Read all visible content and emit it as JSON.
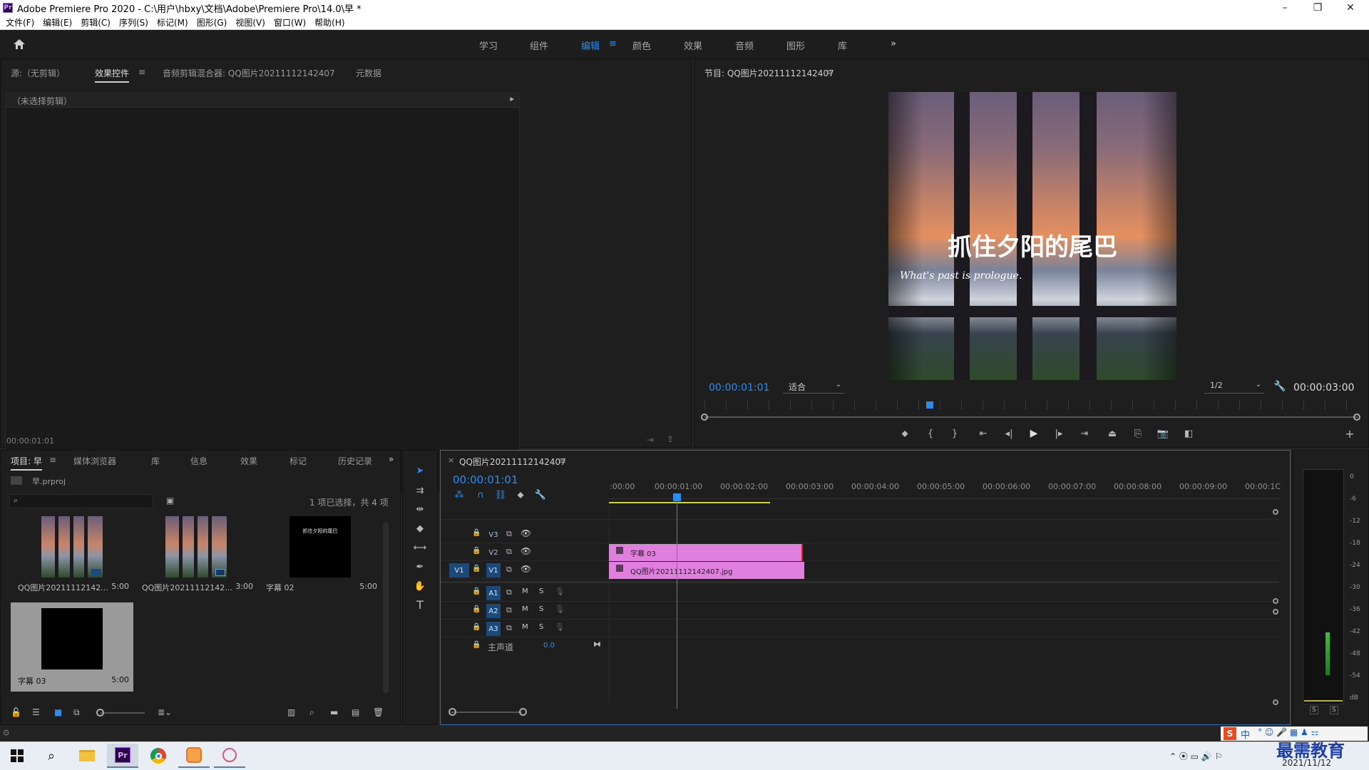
{
  "window": {
    "title": "Adobe Premiere Pro 2020 - C:\\用户\\hbxy\\文档\\Adobe\\Premiere Pro\\14.0\\早 *",
    "logo": "Pr",
    "min": "–",
    "max": "❐",
    "close": "✕"
  },
  "menu": [
    "文件(F)",
    "编辑(E)",
    "剪辑(C)",
    "序列(S)",
    "标记(M)",
    "图形(G)",
    "视图(V)",
    "窗口(W)",
    "帮助(H)"
  ],
  "workspaces": [
    "学习",
    "组件",
    "编辑",
    "颜色",
    "效果",
    "音频",
    "图形",
    "库"
  ],
  "workspace_menu": "≡",
  "workspace_more": "»",
  "source_panel": {
    "tabs": [
      "源:（无剪辑）",
      "效果控件",
      "音频剪辑混合器: QQ图片20211112142407",
      "元数据"
    ],
    "menu": "≡",
    "no_clip": "（未选择剪辑）",
    "timecode": "00:00:01:01"
  },
  "program": {
    "title": "节目: QQ图片20211112142407",
    "menu": "≡",
    "timecode": "00:00:01:01",
    "fit": "适合",
    "quality": "1/2",
    "duration": "00:00:03:00",
    "video_title": "抓住夕阳的尾巴",
    "video_subtitle": "What's past is prologue."
  },
  "project": {
    "tabs": [
      "项目: 早",
      "媒体浏览器",
      "库",
      "信息",
      "效果",
      "标记",
      "历史记录"
    ],
    "menu": "≡",
    "more": "»",
    "file": "早.prproj",
    "status": "1 项已选择，共 4 项",
    "items": [
      {
        "name": "QQ图片2021111214​2...",
        "dur": "5:00"
      },
      {
        "name": "QQ图片2021111214​2...",
        "dur": "3:00"
      },
      {
        "name": "字幕 02",
        "dur": "5:00",
        "text": "抓住夕阳的尾巴"
      },
      {
        "name": "字幕 03",
        "dur": "5:00"
      }
    ]
  },
  "timeline": {
    "title": "QQ图片20211112142407",
    "close": "×",
    "menu": "≡",
    "timecode": "00:00:01:01",
    "ruler": [
      ":00:00",
      "00:00:01:00",
      "00:00:02:00",
      "00:00:03:00",
      "00:00:04:00",
      "00:00:05:00",
      "00:00:06:00",
      "00:00:07:00",
      "00:00:08:00",
      "00:00:09:00",
      "00:00:1C"
    ],
    "video_tracks": [
      "V3",
      "V2",
      "V1"
    ],
    "audio_tracks": [
      "A1",
      "A2",
      "A3"
    ],
    "source_patch_v": "V1",
    "mix": {
      "label": "主声道",
      "value": "0.0"
    },
    "clips": {
      "v2": "字幕 03",
      "v1": "QQ图片20211112142407.jpg"
    },
    "mute": "M",
    "solo": "S"
  },
  "meter": {
    "scale": [
      "0",
      "-6",
      "-12",
      "-18",
      "-24",
      "-30",
      "-36",
      "-42",
      "-48",
      "-54",
      "dB"
    ],
    "solo": [
      "S",
      "S"
    ]
  },
  "taskbar": {
    "time": "",
    "date": "2021/11/12",
    "ime": "中",
    "watermark": "最需教育"
  },
  "colors": {
    "accent": "#2d8ceb",
    "clip": "#e17fde",
    "playhead": "#2d8ceb",
    "workarea": "#d6d62a"
  }
}
